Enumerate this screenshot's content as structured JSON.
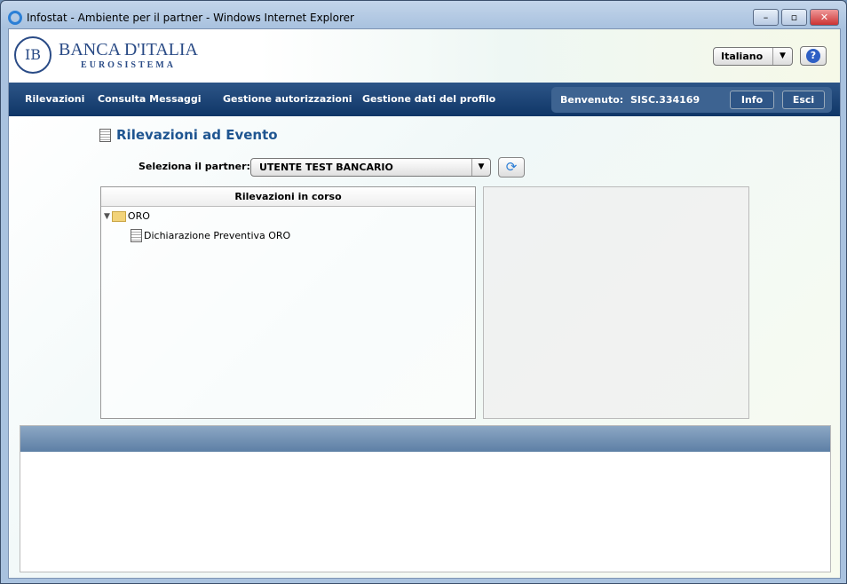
{
  "window": {
    "title": "Infostat - Ambiente per il partner - Windows Internet Explorer",
    "minimize": "–",
    "maximize": "▫",
    "close": "✕"
  },
  "header": {
    "brand": "BANCA D'ITALIA",
    "sub": "EUROSISTEMA",
    "seal": "IB",
    "language": "Italiano",
    "help": "?"
  },
  "nav": {
    "items": [
      "Rilevazioni",
      "Consulta Messaggi",
      "Gestione autorizzazioni",
      "Gestione dati del profilo"
    ],
    "welcome_label": "Benvenuto:",
    "user": "SISC.334169",
    "info": "Info",
    "logout": "Esci"
  },
  "page": {
    "title": "Rilevazioni ad Evento",
    "partner_label": "Seleziona il partner:",
    "partner_value": "UTENTE TEST BANCARIO"
  },
  "tree": {
    "header": "Rilevazioni in corso",
    "folder": "ORO",
    "item": "Dichiarazione Preventiva ORO"
  }
}
